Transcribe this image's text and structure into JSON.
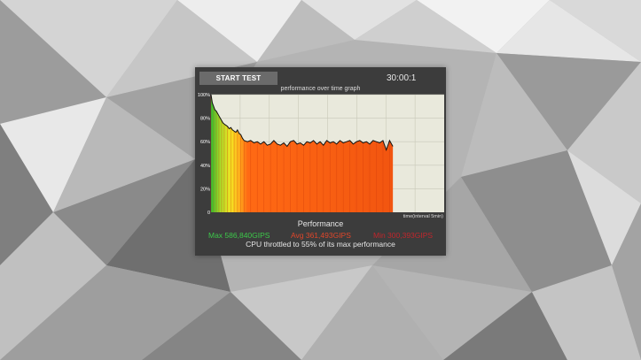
{
  "desktop": {
    "colors": {
      "light": "#e6e6e6",
      "mid": "#a9a9a9",
      "dark": "#6a6a6a"
    }
  },
  "widget": {
    "start_button_label": "START TEST",
    "timer": "30:00:1",
    "graph_title": "performance over time graph",
    "performance_label": "Performance",
    "max_text": "Max 586,840GIPS",
    "avg_text": "Avg 361,493GIPS",
    "min_text": "Min 300,393GIPS",
    "throttle_message": "CPU throttled to 55% of its max performance",
    "colors": {
      "panel": "#3c3c3c",
      "button": "#6b6b6b",
      "max": "#3cc84a",
      "avg": "#e0462a",
      "min": "#c0262c"
    }
  },
  "chart_data": {
    "type": "area",
    "title": "performance over time graph",
    "xlabel": "time(interval 5min)",
    "ylabel": "",
    "yticks": [
      "0",
      "20%",
      "40%",
      "60%",
      "80%",
      "100%"
    ],
    "ylim": [
      0,
      100
    ],
    "xlim": [
      0,
      55
    ],
    "grid": true,
    "background": "#e9e9dc",
    "x": [
      0,
      0.4,
      0.8,
      1.2,
      1.6,
      2,
      2.4,
      2.8,
      3.2,
      3.6,
      4,
      4.5,
      5,
      5.5,
      6,
      6.5,
      7,
      7.5,
      8,
      8.5,
      9,
      9.5,
      10,
      11,
      12,
      13,
      14,
      15,
      16,
      17,
      18,
      19,
      20,
      21,
      22,
      23,
      24,
      25,
      26,
      27,
      28,
      29,
      30,
      31,
      32,
      33,
      34,
      35,
      36,
      37,
      38,
      39,
      40,
      41,
      42,
      43,
      44,
      45,
      46,
      47,
      48,
      49,
      50,
      51,
      52,
      53,
      54,
      55
    ],
    "values": [
      100,
      93,
      90,
      87,
      86,
      84,
      82,
      80,
      78,
      76,
      75,
      74,
      73,
      71,
      72,
      70,
      69,
      68,
      70,
      67,
      66,
      63,
      61,
      60,
      61,
      59,
      60,
      58,
      60,
      57,
      58,
      61,
      58,
      57,
      59,
      56,
      60,
      61,
      58,
      59,
      57,
      60,
      59,
      61,
      58,
      60,
      57,
      61,
      59,
      60,
      58,
      61,
      59,
      60,
      61,
      58,
      60,
      61,
      59,
      60,
      58,
      61,
      60,
      59,
      61,
      53,
      61,
      56
    ]
  }
}
